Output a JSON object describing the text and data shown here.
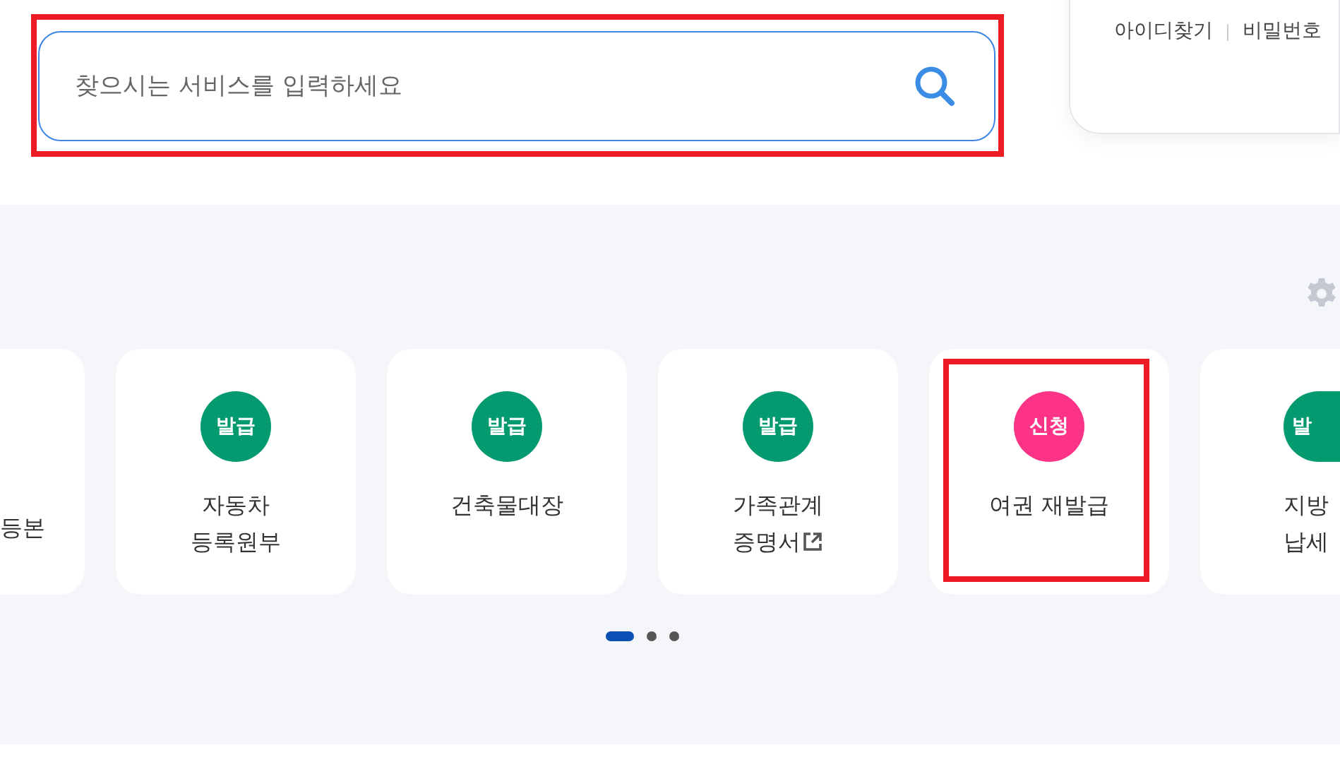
{
  "search": {
    "placeholder": "찾으시는 서비스를 입력하세요"
  },
  "account_links": [
    "아이디찾기",
    "비밀번호"
  ],
  "services": [
    {
      "lines": [
        "등본"
      ]
    },
    {
      "badge": {
        "text": "발급",
        "kind": "issue"
      },
      "lines": [
        "자동차",
        "등록원부"
      ]
    },
    {
      "badge": {
        "text": "발급",
        "kind": "issue"
      },
      "lines": [
        "건축물대장"
      ]
    },
    {
      "badge": {
        "text": "발급",
        "kind": "issue"
      },
      "lines": [
        "가족관계",
        "증명서"
      ],
      "external": true
    },
    {
      "badge": {
        "text": "신청",
        "kind": "apply"
      },
      "lines": [
        "여권 재발급"
      ],
      "highlighted": true
    },
    {
      "badge": {
        "text": "발",
        "kind": "issue"
      },
      "lines": [
        "지방",
        "납세"
      ]
    }
  ],
  "pager": [
    {
      "selected": true
    },
    {
      "selected": false
    },
    {
      "selected": false
    }
  ]
}
